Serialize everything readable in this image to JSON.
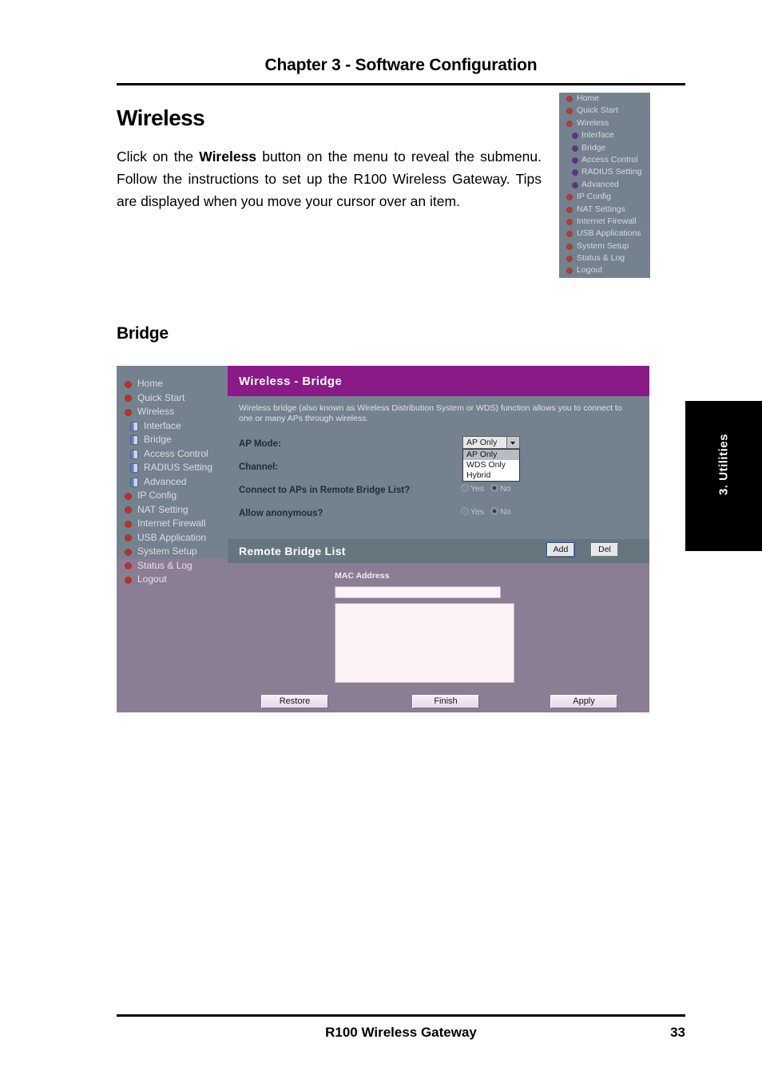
{
  "page": {
    "chapter_title": "Chapter 3 - Software Configuration",
    "footer_title": "R100 Wireless Gateway",
    "page_number": "33",
    "side_tab_label": "3. Utilities"
  },
  "sections": {
    "wireless_heading": "Wireless",
    "wireless_paragraph_prefix": "Click on the ",
    "wireless_paragraph_bold": "Wireless",
    "wireless_paragraph_suffix": " button on the menu to reveal the submenu. Follow the instructions to set up the R100 Wireless Gateway. Tips are displayed when you move your cursor over an item.",
    "bridge_heading": "Bridge"
  },
  "mini_menu": {
    "items": [
      {
        "label": "Home",
        "sub": false
      },
      {
        "label": "Quick Start",
        "sub": false
      },
      {
        "label": "Wireless",
        "sub": false
      },
      {
        "label": "Interface",
        "sub": true
      },
      {
        "label": "Bridge",
        "sub": true
      },
      {
        "label": "Access Control",
        "sub": true
      },
      {
        "label": "RADIUS Setting",
        "sub": true
      },
      {
        "label": "Advanced",
        "sub": true
      },
      {
        "label": "IP Config",
        "sub": false
      },
      {
        "label": "NAT Settings",
        "sub": false
      },
      {
        "label": "Internet Firewall",
        "sub": false
      },
      {
        "label": "USB Applications",
        "sub": false
      },
      {
        "label": "System Setup",
        "sub": false
      },
      {
        "label": "Status & Log",
        "sub": false
      },
      {
        "label": "Logout",
        "sub": false
      }
    ]
  },
  "screenshot": {
    "nav_items": [
      {
        "label": "Home",
        "sub": false
      },
      {
        "label": "Quick Start",
        "sub": false
      },
      {
        "label": "Wireless",
        "sub": false
      },
      {
        "label": "Interface",
        "sub": true
      },
      {
        "label": "Bridge",
        "sub": true
      },
      {
        "label": "Access Control",
        "sub": true
      },
      {
        "label": "RADIUS Setting",
        "sub": true
      },
      {
        "label": "Advanced",
        "sub": true
      },
      {
        "label": "IP Config",
        "sub": false
      },
      {
        "label": "NAT Setting",
        "sub": false
      },
      {
        "label": "Internet Firewall",
        "sub": false
      },
      {
        "label": "USB Application",
        "sub": false
      },
      {
        "label": "System Setup",
        "sub": false
      },
      {
        "label": "Status & Log",
        "sub": false
      },
      {
        "label": "Logout",
        "sub": false
      }
    ],
    "title": "Wireless - Bridge",
    "intro": "Wireless bridge (also known as Wireless Distribution System or WDS) function allows you to connect to one or many APs through wireless.",
    "fields": {
      "ap_mode_label": "AP Mode:",
      "ap_mode_value": "AP Only",
      "ap_mode_options": [
        "AP Only",
        "WDS Only",
        "Hybrid"
      ],
      "channel_label": "Channel:",
      "connect_label": "Connect to APs in Remote Bridge List?",
      "connect_yes": "Yes",
      "connect_no": "No",
      "connect_value": "No",
      "anonymous_label": "Allow anonymous?",
      "anonymous_yes": "Yes",
      "anonymous_no": "No",
      "anonymous_value": "No"
    },
    "remote_bridge_list": {
      "title": "Remote Bridge List",
      "add_label": "Add",
      "del_label": "Del",
      "mac_label": "MAC Address",
      "mac_value": "",
      "list_items": []
    },
    "buttons": {
      "restore": "Restore",
      "finish": "Finish",
      "apply": "Apply"
    },
    "colors": {
      "title_bar": "#8a1a87",
      "panel_slate": "#74828f",
      "panel_mauve": "#8b7d94",
      "bullet_red": "#cc2a1c",
      "bullet_purple": "#6b2a8f"
    }
  }
}
